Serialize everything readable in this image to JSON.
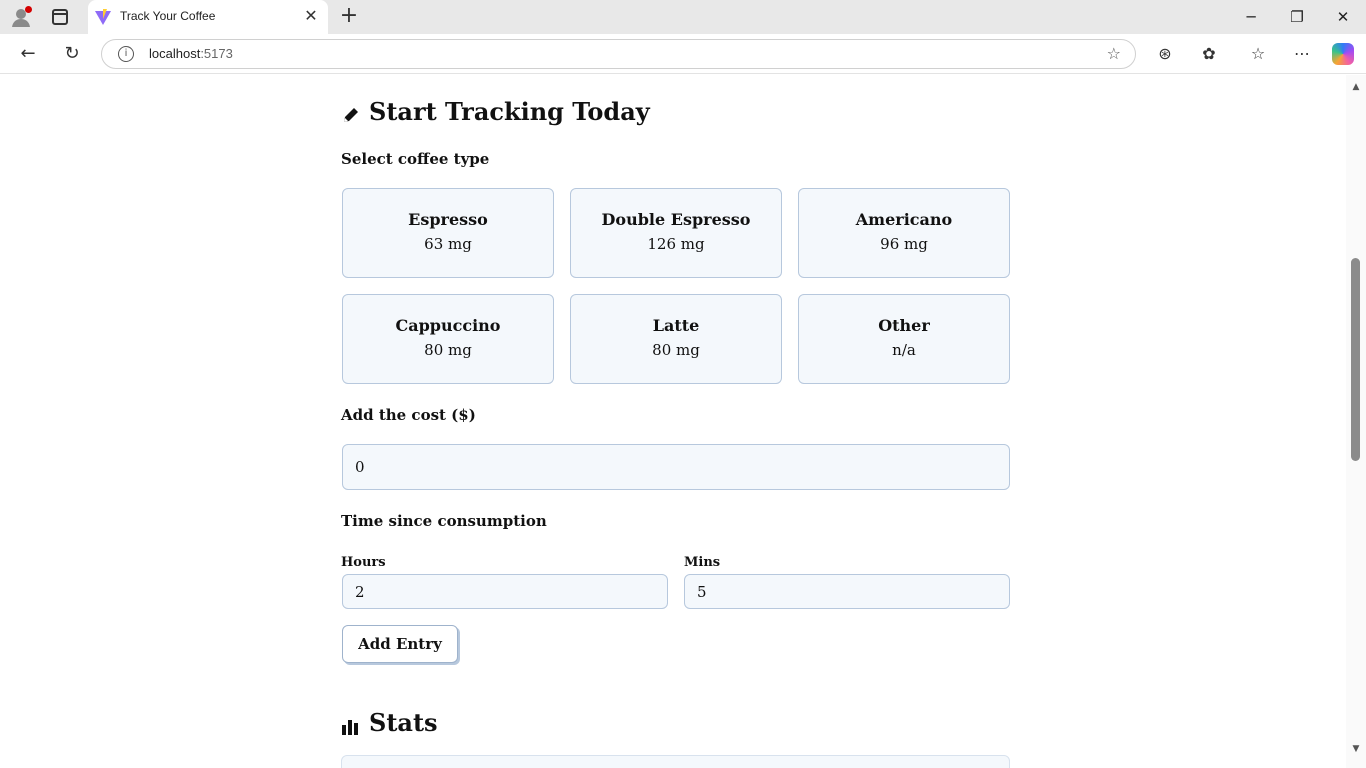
{
  "browser": {
    "tab_title": "Track Your Coffee",
    "url_host": "localhost",
    "url_port": ":5173"
  },
  "page": {
    "tracking_title": "Start Tracking Today",
    "select_type_label": "Select coffee type",
    "coffee_types": [
      {
        "name": "Espresso",
        "caffeine": "63 mg"
      },
      {
        "name": "Double Espresso",
        "caffeine": "126 mg"
      },
      {
        "name": "Americano",
        "caffeine": "96 mg"
      },
      {
        "name": "Cappuccino",
        "caffeine": "80 mg"
      },
      {
        "name": "Latte",
        "caffeine": "80 mg"
      },
      {
        "name": "Other",
        "caffeine": "n/a"
      }
    ],
    "cost_label": "Add the cost ($)",
    "cost_value": "0",
    "time_label": "Time since consumption",
    "hours_label": "Hours",
    "hours_value": "2",
    "mins_label": "Mins",
    "mins_value": "5",
    "add_button": "Add Entry",
    "stats_title": "Stats"
  },
  "colors": {
    "card_background": "#f4f8fc",
    "card_border": "#b7c8dd"
  }
}
